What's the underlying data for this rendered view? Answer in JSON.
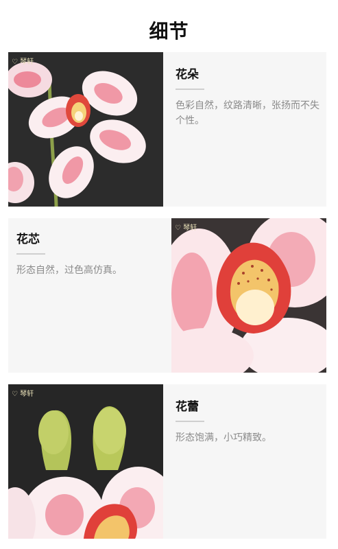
{
  "page_title": "细节",
  "sections": [
    {
      "heading": "花朵",
      "description": "色彩自然，纹路清晰，张扬而不失个性。"
    },
    {
      "heading": "花芯",
      "description": "形态自然，过色高仿真。"
    },
    {
      "heading": "花蕾",
      "description": "形态饱满，小巧精致。"
    }
  ],
  "brand_mark": "琴轩",
  "colors": {
    "petal_pink": "#e8526a",
    "petal_white": "#fbeef0",
    "bud_green": "#b9c85a",
    "card_bg": "#f6f6f6"
  }
}
